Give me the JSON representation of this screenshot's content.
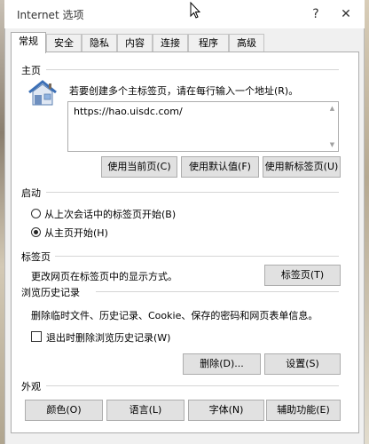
{
  "window": {
    "title": "Internet 选项",
    "help_label": "?",
    "close_label": "✕"
  },
  "tabs": [
    {
      "label": "常规",
      "active": true
    },
    {
      "label": "安全"
    },
    {
      "label": "隐私"
    },
    {
      "label": "内容"
    },
    {
      "label": "连接"
    },
    {
      "label": "程序"
    },
    {
      "label": "高级"
    }
  ],
  "homepage": {
    "heading": "主页",
    "description": "若要创建多个主标签页，请在每行输入一个地址(R)。",
    "url": "https://hao.uisdc.com/",
    "btn_use_current": "使用当前页(C)",
    "btn_use_default": "使用默认值(F)",
    "btn_use_new_tab": "使用新标签页(U)",
    "icon": "house-icon"
  },
  "startup": {
    "heading": "启动",
    "option_last_session": "从上次会话中的标签页开始(B)",
    "option_homepage": "从主页开始(H)",
    "selected": "homepage"
  },
  "tabs_section": {
    "heading": "标签页",
    "description": "更改网页在标签页中的显示方式。",
    "btn_tabs": "标签页(T)"
  },
  "history": {
    "heading": "浏览历史记录",
    "description": "删除临时文件、历史记录、Cookie、保存的密码和网页表单信息。",
    "checkbox_label": "退出时删除浏览历史记录(W)",
    "checked": false,
    "btn_delete": "删除(D)...",
    "btn_settings": "设置(S)"
  },
  "appearance": {
    "heading": "外观",
    "btn_colors": "颜色(O)",
    "btn_languages": "语言(L)",
    "btn_fonts": "字体(N)",
    "btn_accessibility": "辅助功能(E)"
  }
}
